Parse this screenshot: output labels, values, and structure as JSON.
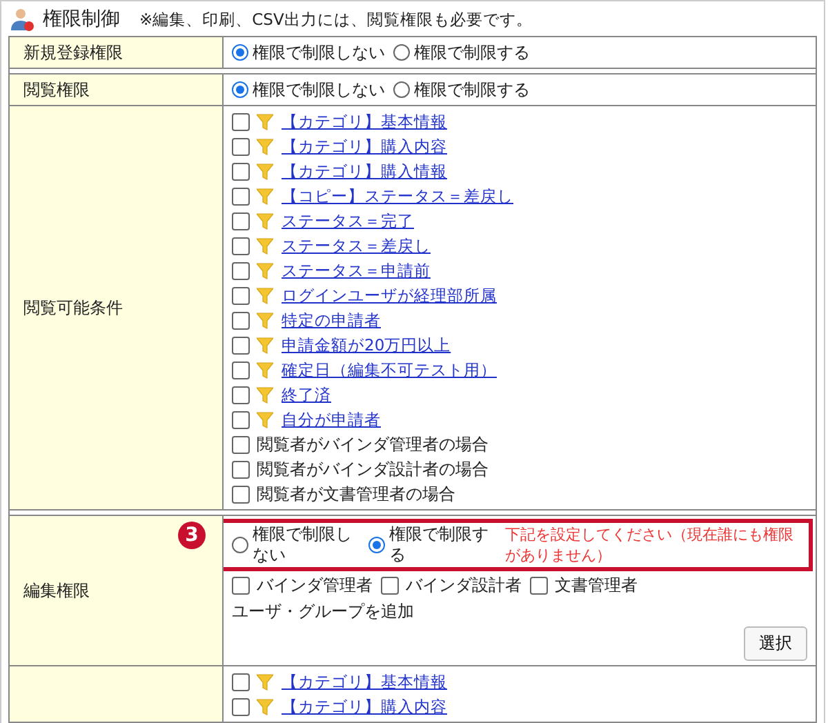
{
  "header": {
    "title": "権限制御",
    "note": "※編集、印刷、CSV出力には、閲覧権限も必要です。"
  },
  "groups": [
    [
      {
        "kind": "radio",
        "label": "新規登録権限",
        "options": [
          {
            "label": "権限で制限しない",
            "selected": true
          },
          {
            "label": "権限で制限する",
            "selected": false
          }
        ]
      }
    ],
    [
      {
        "kind": "radio",
        "label": "閲覧権限",
        "options": [
          {
            "label": "権限で制限しない",
            "selected": true
          },
          {
            "label": "権限で制限する",
            "selected": false
          }
        ]
      },
      {
        "kind": "conditions",
        "label": "閲覧可能条件",
        "items": [
          {
            "kind": "filter",
            "label": "【カテゴリ】基本情報",
            "checked": false
          },
          {
            "kind": "filter",
            "label": "【カテゴリ】購入内容",
            "checked": false
          },
          {
            "kind": "filter",
            "label": "【カテゴリ】購入情報",
            "checked": false
          },
          {
            "kind": "filter",
            "label": "【コピー】ステータス＝差戻し",
            "checked": false
          },
          {
            "kind": "filter",
            "label": "ステータス＝完了",
            "checked": false
          },
          {
            "kind": "filter",
            "label": "ステータス＝差戻し",
            "checked": false
          },
          {
            "kind": "filter",
            "label": "ステータス＝申請前",
            "checked": false
          },
          {
            "kind": "filter",
            "label": "ログインユーザが経理部所属",
            "checked": false
          },
          {
            "kind": "filter",
            "label": "特定の申請者",
            "checked": false
          },
          {
            "kind": "filter",
            "label": "申請金額が20万円以上",
            "checked": false
          },
          {
            "kind": "filter",
            "label": "確定日（編集不可テスト用）",
            "checked": false
          },
          {
            "kind": "filter",
            "label": "終了済",
            "checked": false
          },
          {
            "kind": "filter",
            "label": "自分が申請者",
            "checked": false
          },
          {
            "kind": "plain",
            "label": "閲覧者がバインダ管理者の場合",
            "checked": false
          },
          {
            "kind": "plain",
            "label": "閲覧者がバインダ設計者の場合",
            "checked": false
          },
          {
            "kind": "plain",
            "label": "閲覧者が文書管理者の場合",
            "checked": false
          }
        ]
      }
    ],
    [
      {
        "kind": "edit",
        "label": "編集権限",
        "badge": "3",
        "options": [
          {
            "label": "権限で制限しない",
            "selected": false
          },
          {
            "label": "権限で制限する",
            "selected": true
          }
        ],
        "warning": "下記を設定してください（現在誰にも権限がありません）",
        "roles": [
          {
            "label": "バインダ管理者",
            "checked": false
          },
          {
            "label": "バインダ設計者",
            "checked": false
          },
          {
            "label": "文書管理者",
            "checked": false
          }
        ],
        "add_label": "ユーザ・グループを追加",
        "button": "選択"
      },
      {
        "kind": "conditions",
        "items": [
          {
            "kind": "filter",
            "label": "【カテゴリ】基本情報",
            "checked": false
          },
          {
            "kind": "filter",
            "label": "【カテゴリ】購入内容",
            "checked": false
          }
        ]
      }
    ]
  ]
}
